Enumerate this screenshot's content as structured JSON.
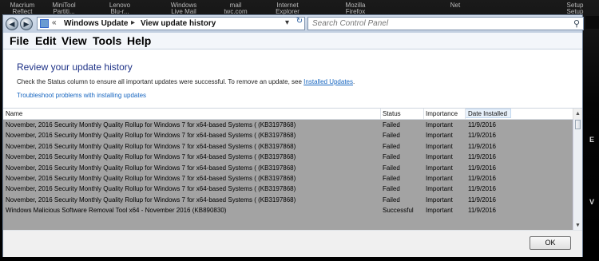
{
  "desktop": {
    "top_icons": [
      "Macrium",
      "MiniTool",
      "Lenovo",
      "Windows",
      "mail",
      "Internet",
      "Mozilla",
      "Net",
      "Setup"
    ],
    "top_icons_line2": [
      "Reflect",
      "Partiti...",
      "Blu-r...",
      "Live Mail",
      "twc.com",
      "Explorer",
      "Firefox",
      "",
      "Setup"
    ],
    "right_edge_labels": [
      "V",
      "E"
    ]
  },
  "address_bar": {
    "crumbs": [
      "Windows Update",
      "View update history"
    ],
    "search_placeholder": "Search Control Panel"
  },
  "menu": [
    "File",
    "Edit",
    "View",
    "Tools",
    "Help"
  ],
  "content": {
    "title": "Review your update history",
    "description_prefix": "Check the Status column to ensure all important updates were successful. To remove an update, see ",
    "description_link": "Installed Updates",
    "description_suffix": ".",
    "troubleshoot_link": "Troubleshoot problems with installing updates"
  },
  "table": {
    "columns": [
      "Name",
      "Status",
      "Importance",
      "Date Installed"
    ],
    "rows": [
      {
        "name": "November, 2016 Security Monthly Quality Rollup for Windows 7 for x64-based Systems ( (KB3197868)",
        "status": "Failed",
        "importance": "Important",
        "date": "11/9/2016"
      },
      {
        "name": "November, 2016 Security Monthly Quality Rollup for Windows 7 for x64-based Systems ( (KB3197868)",
        "status": "Failed",
        "importance": "Important",
        "date": "11/9/2016"
      },
      {
        "name": "November, 2016 Security Monthly Quality Rollup for Windows 7 for x64-based Systems ( (KB3197868)",
        "status": "Failed",
        "importance": "Important",
        "date": "11/9/2016"
      },
      {
        "name": "November, 2016 Security Monthly Quality Rollup for Windows 7 for x64-based Systems ( (KB3197868)",
        "status": "Failed",
        "importance": "Important",
        "date": "11/9/2016"
      },
      {
        "name": "November, 2016 Security Monthly Quality Rollup for Windows 7 for x64-based Systems ( (KB3197868)",
        "status": "Failed",
        "importance": "Important",
        "date": "11/9/2016"
      },
      {
        "name": "November, 2016 Security Monthly Quality Rollup for Windows 7 for x64-based Systems ( (KB3197868)",
        "status": "Failed",
        "importance": "Important",
        "date": "11/9/2016"
      },
      {
        "name": "November, 2016 Security Monthly Quality Rollup for Windows 7 for x64-based Systems ( (KB3197868)",
        "status": "Failed",
        "importance": "Important",
        "date": "11/9/2016"
      },
      {
        "name": "November, 2016 Security Monthly Quality Rollup for Windows 7 for x64-based Systems ( (KB3197868)",
        "status": "Failed",
        "importance": "Important",
        "date": "11/9/2016"
      },
      {
        "name": "Windows Malicious Software Removal Tool x64 - November 2016 (KB890830)",
        "status": "Successful",
        "importance": "Important",
        "date": "11/9/2016"
      }
    ]
  },
  "buttons": {
    "ok": "OK"
  },
  "colors": {
    "selection_gray": "#a3a3a3",
    "link_blue": "#1766c0",
    "title_blue": "#1e3287"
  }
}
